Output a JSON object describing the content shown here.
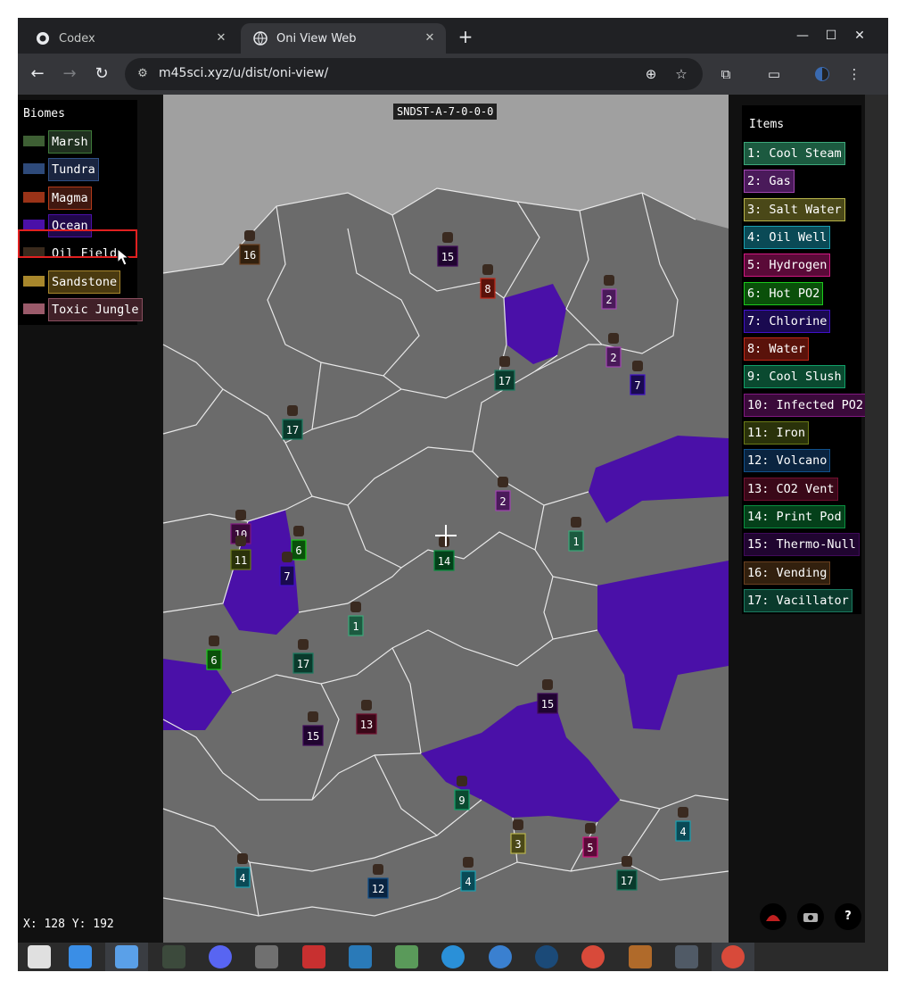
{
  "browser": {
    "tabs": [
      {
        "title": "Codex",
        "icon": "codex-icon",
        "active": false
      },
      {
        "title": "Oni View Web",
        "icon": "globe-icon",
        "active": true
      }
    ],
    "new_tab": "+",
    "controls": {
      "minimize": "—",
      "maximize": "☐",
      "close": "✕"
    },
    "url": "m45sci.xyz/u/dist/oni-view/"
  },
  "app": {
    "seed": "SNDST-A-7-0-0-0",
    "biomes_title": "Biomes",
    "biomes": [
      {
        "label": "Marsh",
        "color": "#3e5f34",
        "border": "#3f7a3a",
        "bg": "#203020"
      },
      {
        "label": "Tundra",
        "color": "#2e4a7a",
        "border": "#2f4f86",
        "bg": "#1a2540"
      },
      {
        "label": "Magma",
        "color": "#9a3318",
        "border": "#b33a1a",
        "bg": "#401810"
      },
      {
        "label": "Ocean",
        "color": "#4a10a8",
        "border": "#4a10a8",
        "bg": "#20084a"
      },
      {
        "label": "Oil Field",
        "color": "#3a2a1c",
        "border": "#000000",
        "bg": "#000000"
      },
      {
        "label": "Sandstone",
        "color": "#a8872c",
        "border": "#a8872c",
        "bg": "#4a3a10"
      },
      {
        "label": "Toxic Jungle",
        "color": "#9a5a6a",
        "border": "#8a5060",
        "bg": "#402028"
      }
    ],
    "items_title": "Items",
    "items": [
      {
        "label": "1: Cool Steam",
        "color": "#3ca87a",
        "bg": "#1c5a40"
      },
      {
        "label": "2: Gas",
        "color": "#a046b0",
        "bg": "#4a1a5a"
      },
      {
        "label": "3: Salt Water",
        "color": "#b8b44a",
        "bg": "#4a4818"
      },
      {
        "label": "4: Oil Well",
        "color": "#1aa0b0",
        "bg": "#0a4a56"
      },
      {
        "label": "5: Hydrogen",
        "color": "#d01880",
        "bg": "#5a0a38"
      },
      {
        "label": "6: Hot PO2",
        "color": "#1cc81c",
        "bg": "#0a500a"
      },
      {
        "label": "7: Chlorine",
        "color": "#4010c8",
        "bg": "#1a0a50"
      },
      {
        "label": "8: Water",
        "color": "#c02818",
        "bg": "#5a120a"
      },
      {
        "label": "9: Cool Slush",
        "color": "#10a068",
        "bg": "#0a4a30"
      },
      {
        "label": "10: Infected PO2",
        "color": "#801880",
        "bg": "#3a0a3a"
      },
      {
        "label": "11: Iron",
        "color": "#6a7a18",
        "bg": "#2a320a"
      },
      {
        "label": "12: Volcano",
        "color": "#10508a",
        "bg": "#0a2440"
      },
      {
        "label": "13: CO2 Vent",
        "color": "#701030",
        "bg": "#3a0818"
      },
      {
        "label": "14: Print Pod",
        "color": "#0a9040",
        "bg": "#04401a"
      },
      {
        "label": "15: Thermo-Null",
        "color": "#400a5a",
        "bg": "#200530"
      },
      {
        "label": "16: Vending",
        "color": "#6a4020",
        "bg": "#32200e"
      },
      {
        "label": "17: Vacillator",
        "color": "#1a7a60",
        "bg": "#0a3a2c"
      }
    ],
    "map_markers": [
      "16",
      "15",
      "8",
      "2",
      "2",
      "7",
      "17",
      "17",
      "2",
      "10",
      "11",
      "6",
      "7",
      "1",
      "14",
      "1",
      "6",
      "17",
      "15",
      "13",
      "15",
      "9",
      "3",
      "5",
      "4",
      "4",
      "12",
      "4",
      "17"
    ],
    "cursor_coords": "X: 128 Y: 192",
    "bottom_buttons": [
      "oil-icon",
      "camera-icon",
      "?"
    ]
  },
  "taskbar": {
    "apps": [
      {
        "name": "start-icon",
        "color": "#e0e0e0"
      },
      {
        "name": "store-icon",
        "color": "#3a8ee6"
      },
      {
        "name": "files-icon",
        "color": "#5aa0e8"
      },
      {
        "name": "terminal-icon",
        "color": "#3c4a3c"
      },
      {
        "name": "discord-icon",
        "color": "#5865f2"
      },
      {
        "name": "calculator-icon",
        "color": "#707070"
      },
      {
        "name": "filezilla-icon",
        "color": "#c83030"
      },
      {
        "name": "writer-icon",
        "color": "#2a7ab8"
      },
      {
        "name": "network-icon",
        "color": "#5a9a5a"
      },
      {
        "name": "remote-icon",
        "color": "#2a90d8"
      },
      {
        "name": "settings-icon",
        "color": "#3a80d0"
      },
      {
        "name": "steam-icon",
        "color": "#1b4a78"
      },
      {
        "name": "chrome-icon",
        "color": "#d84a3a"
      },
      {
        "name": "circuit-icon",
        "color": "#b06a2a"
      },
      {
        "name": "mixer-icon",
        "color": "#505a66"
      },
      {
        "name": "chrome-active-icon",
        "color": "#d84a3a"
      }
    ]
  }
}
